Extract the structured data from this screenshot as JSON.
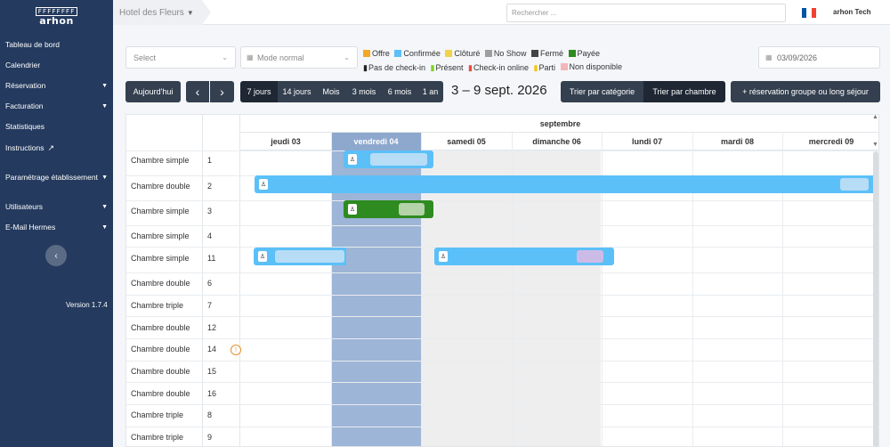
{
  "sidebar": {
    "logo_top": "FFFFFFFF",
    "logo_text": "arhon",
    "items": [
      {
        "label": "Tableau de bord",
        "chevron": false
      },
      {
        "label": "Calendrier",
        "chevron": false
      },
      {
        "label": "Réservation",
        "chevron": true
      },
      {
        "label": "Facturation",
        "chevron": true
      },
      {
        "label": "Statistiques",
        "chevron": false
      },
      {
        "label": "Instructions",
        "chevron": false,
        "icon": "external-link-icon"
      },
      {
        "label": "Paramétrage établissement",
        "chevron": true
      },
      {
        "label": "Utilisateurs",
        "chevron": true
      },
      {
        "label": "E-Mail Hermes",
        "chevron": true
      }
    ],
    "collapse_icon": "‹",
    "version": "Version 1.7.4"
  },
  "topbar": {
    "hotel": "Hotel des Fleurs",
    "search_placeholder": "Rechercher ...",
    "user": "arhon Tech",
    "flag_colors": [
      "#0055a4",
      "#ffffff",
      "#ef4135"
    ]
  },
  "filters": {
    "select_placeholder": "Select",
    "mode": "Mode normal",
    "date": "03/09/2026"
  },
  "legend": {
    "colors": [
      {
        "label": "Offre",
        "color": "#f5a623"
      },
      {
        "label": "Confirmée",
        "color": "#5bc0f8"
      },
      {
        "label": "Clôturé",
        "color": "#f0d34a"
      },
      {
        "label": "No Show",
        "color": "#9e9e9e"
      },
      {
        "label": "Fermé",
        "color": "#444444"
      },
      {
        "label": "Payée",
        "color": "#2e8b1f"
      }
    ],
    "people": [
      {
        "label": "Pas de check-in",
        "color": "#222222"
      },
      {
        "label": "Présent",
        "color": "#7ed321"
      },
      {
        "label": "Check-in online",
        "color": "#e74c3c"
      },
      {
        "label": "Parti",
        "color": "#f5c518"
      }
    ],
    "unavailable": {
      "label": "Non disponible",
      "color": "#f4b6bb"
    }
  },
  "controls": {
    "today": "Aujourd'hui",
    "prev": "‹",
    "next": "›",
    "periods": [
      "7 jours",
      "14 jours",
      "Mois",
      "3 mois",
      "6 mois",
      "1 an"
    ],
    "active_period": "7 jours",
    "range": "3 – 9 sept. 2026",
    "sort_category": "Trier par catégorie",
    "sort_room": "Trier par chambre",
    "group_booking": "+ réservation groupe ou long séjour"
  },
  "calendar": {
    "month": "septembre",
    "days": [
      "jeudi 03",
      "vendredi 04",
      "samedi 05",
      "dimanche 06",
      "lundi 07",
      "mardi 08",
      "mercredi 09"
    ],
    "rooms": [
      {
        "name": "Chambre simple",
        "num": "1"
      },
      {
        "name": "Chambre double",
        "num": "2"
      },
      {
        "name": "Chambre simple",
        "num": "3"
      },
      {
        "name": "Chambre simple",
        "num": "4"
      },
      {
        "name": "Chambre simple",
        "num": "11"
      },
      {
        "name": "Chambre double",
        "num": "6"
      },
      {
        "name": "Chambre triple",
        "num": "7"
      },
      {
        "name": "Chambre double",
        "num": "12"
      },
      {
        "name": "Chambre double",
        "num": "14"
      },
      {
        "name": "Chambre double",
        "num": "15"
      },
      {
        "name": "Chambre double",
        "num": "16"
      },
      {
        "name": "Chambre triple",
        "num": "8"
      },
      {
        "name": "Chambre triple",
        "num": "9"
      }
    ],
    "reservations": [
      {
        "room": "1",
        "status": "Confirmée",
        "color": "#5bc0f8"
      },
      {
        "room": "2",
        "status": "Confirmée",
        "color": "#5bc0f8"
      },
      {
        "room": "3",
        "status": "Payée",
        "color": "#2e8b1f"
      },
      {
        "room": "11",
        "status": "Confirmée",
        "color": "#5bc0f8"
      },
      {
        "room": "11",
        "status": "Confirmée",
        "color": "#5bc0f8"
      }
    ],
    "warning_icon": "!"
  }
}
